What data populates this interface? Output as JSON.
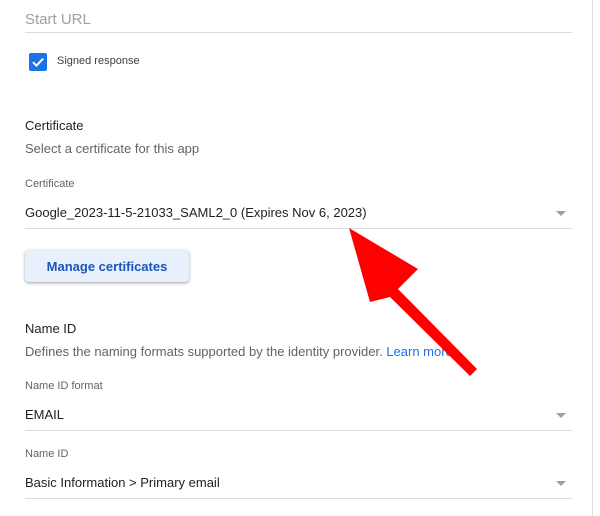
{
  "start_url": {
    "placeholder": "Start URL",
    "value": ""
  },
  "signed_response": {
    "label": "Signed response",
    "checked": true
  },
  "certificate_section": {
    "title": "Certificate",
    "description": "Select a certificate for this app",
    "field_label": "Certificate",
    "selected_value": "Google_2023-11-5-21033_SAML2_0 (Expires Nov 6, 2023)",
    "manage_button_label": "Manage certificates"
  },
  "name_id_section": {
    "title": "Name ID",
    "description": "Defines the naming formats supported by the identity provider. ",
    "learn_more_label": "Learn more",
    "format_label": "Name ID format",
    "format_value": "EMAIL",
    "name_id_label": "Name ID",
    "name_id_value": "Basic Information > Primary email"
  },
  "annotation": {
    "arrow_color": "#ff0000",
    "target": "certificate-select"
  },
  "colors": {
    "accent": "#1a73e8",
    "button_bg": "#e8f0fe",
    "button_text": "#1a56b4"
  }
}
